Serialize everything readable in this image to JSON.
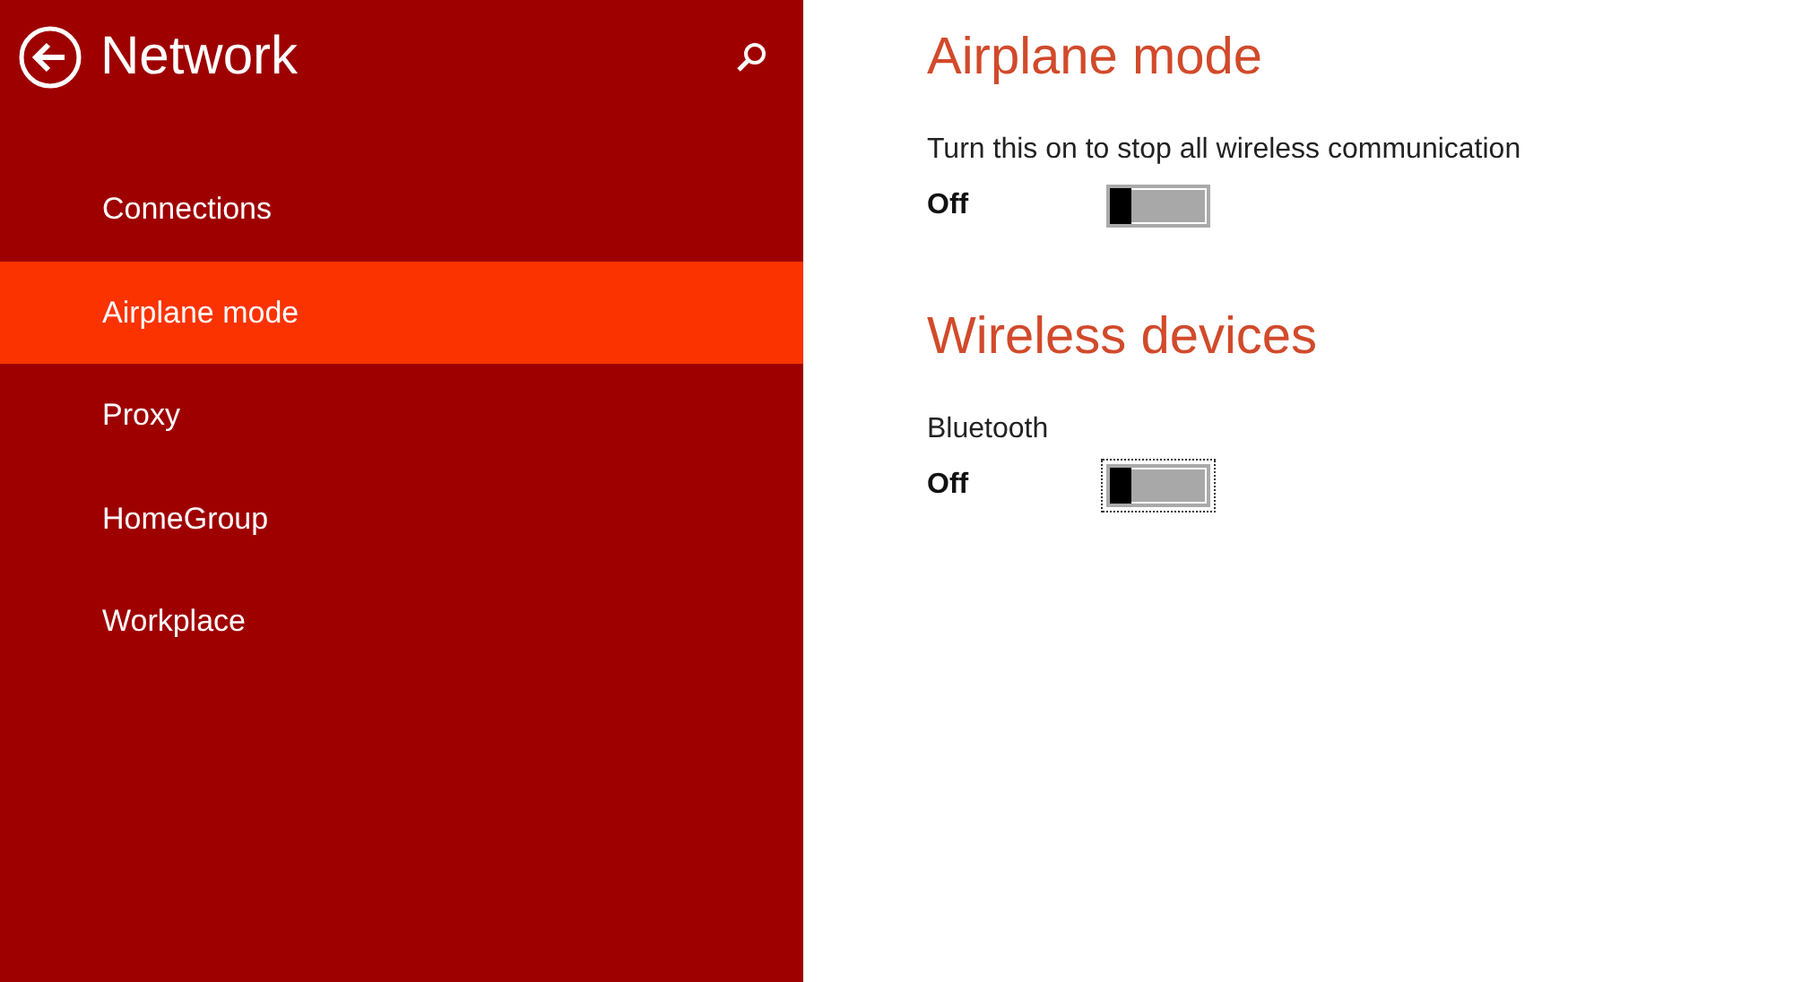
{
  "sidebar": {
    "title": "Network",
    "items": [
      {
        "label": "Connections",
        "selected": false
      },
      {
        "label": "Airplane mode",
        "selected": true
      },
      {
        "label": "Proxy",
        "selected": false
      },
      {
        "label": "HomeGroup",
        "selected": false
      },
      {
        "label": "Workplace",
        "selected": false
      }
    ]
  },
  "sections": [
    {
      "heading": "Airplane mode",
      "settings": [
        {
          "label": "Turn this on to stop all wireless communication",
          "state_text": "Off",
          "on": false,
          "focused": false
        }
      ]
    },
    {
      "heading": "Wireless devices",
      "settings": [
        {
          "label": "Bluetooth",
          "state_text": "Off",
          "on": false,
          "focused": true
        }
      ]
    }
  ]
}
